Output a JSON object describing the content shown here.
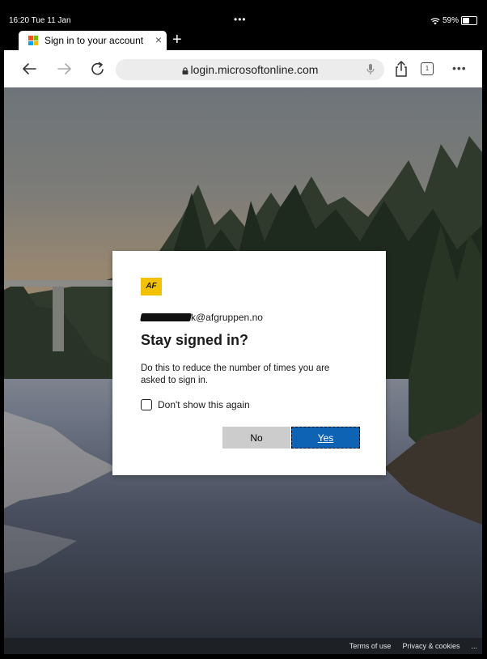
{
  "status_bar": {
    "time": "16:20  Tue 11 Jan",
    "battery": "59%",
    "battery_level": 0.59,
    "dots": "•••"
  },
  "tab": {
    "title": "Sign in to your account",
    "close": "×",
    "new_tab": "+"
  },
  "toolbar": {
    "url": "login.microsoftonline.com",
    "tab_count": "1",
    "more": "•••"
  },
  "dialog": {
    "logo_text": "AF",
    "email_suffix": "k@afgruppen.no",
    "title": "Stay signed in?",
    "description": "Do this to reduce the number of times you are asked to sign in.",
    "checkbox_label": "Don't show this again",
    "no_label": "No",
    "yes_label": "Yes"
  },
  "footer": {
    "terms": "Terms of use",
    "privacy": "Privacy & cookies",
    "more": "..."
  },
  "colors": {
    "accent": "#0f63b5",
    "logo_yellow": "#f2c200",
    "ms_red": "#f25022",
    "ms_green": "#7fba00",
    "ms_blue": "#00a4ef",
    "ms_yellow": "#ffb900"
  }
}
